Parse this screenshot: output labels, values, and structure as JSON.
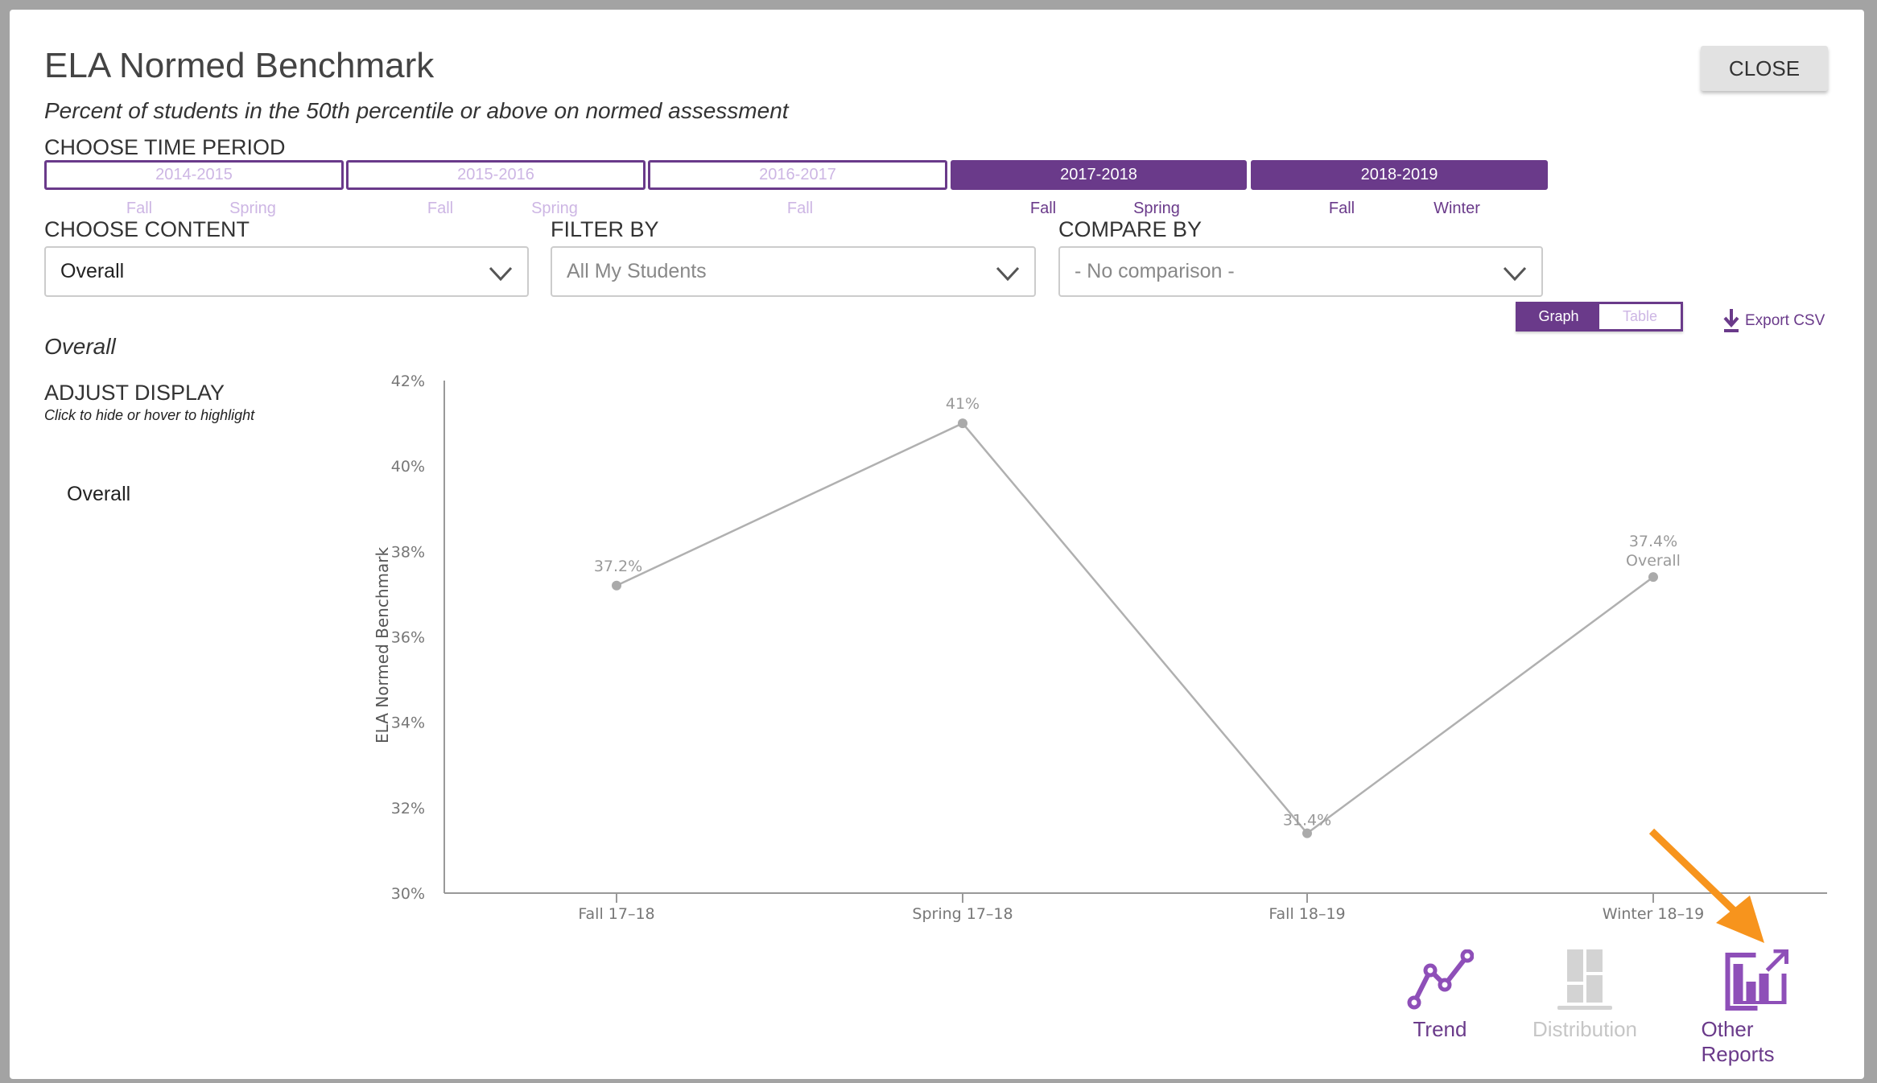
{
  "modal": {
    "title": "ELA Normed Benchmark",
    "subtitle": "Percent of students in the 50th percentile or above on normed assessment",
    "close_label": "CLOSE"
  },
  "time_period": {
    "label": "CHOOSE TIME PERIOD",
    "years": [
      {
        "label": "2014-2015",
        "selected": false,
        "seasons": [
          "Fall",
          "Spring"
        ]
      },
      {
        "label": "2015-2016",
        "selected": false,
        "seasons": [
          "Fall",
          "Spring"
        ]
      },
      {
        "label": "2016-2017",
        "selected": false,
        "seasons": [
          "Fall"
        ]
      },
      {
        "label": "2017-2018",
        "selected": true,
        "seasons": [
          "Fall",
          "Spring"
        ]
      },
      {
        "label": "2018-2019",
        "selected": true,
        "seasons": [
          "Fall",
          "Winter"
        ]
      }
    ]
  },
  "filters": {
    "content_label": "CHOOSE CONTENT",
    "content_value": "Overall",
    "filter_label": "FILTER BY",
    "filter_value": "All My Students",
    "compare_label": "COMPARE BY",
    "compare_value": "- No comparison -"
  },
  "view_toggle": {
    "graph": "Graph",
    "table": "Table",
    "active": "Graph"
  },
  "export_label": "Export CSV",
  "section_title": "Overall",
  "adjust": {
    "title": "ADJUST DISPLAY",
    "hint": "Click to hide or hover to highlight",
    "items": [
      "Overall"
    ]
  },
  "colors": {
    "accent": "#6a3a8a",
    "icon_purple": "#8e4fb8",
    "line": "#b0b0b0",
    "arrow": "#f7941d"
  },
  "chart_data": {
    "type": "line",
    "ylabel": "ELA Normed Benchmark",
    "categories": [
      "Fall 17–18",
      "Spring 17–18",
      "Fall 18–19",
      "Winter 18–19"
    ],
    "yticks": [
      "30%",
      "32%",
      "34%",
      "36%",
      "38%",
      "40%",
      "42%"
    ],
    "ylim": [
      30,
      42
    ],
    "series": [
      {
        "name": "Overall",
        "values": [
          37.2,
          41,
          31.4,
          37.4
        ],
        "labels": [
          "37.2%",
          "41%",
          "31.4%",
          "37.4%"
        ]
      }
    ],
    "grid": false
  },
  "bottom_nav": [
    {
      "label": "Trend",
      "icon": "trend-icon",
      "active": true
    },
    {
      "label": "Distribution",
      "icon": "distribution-icon",
      "active": false
    },
    {
      "label": "Other Reports",
      "icon": "other-reports-icon",
      "active": true
    }
  ]
}
